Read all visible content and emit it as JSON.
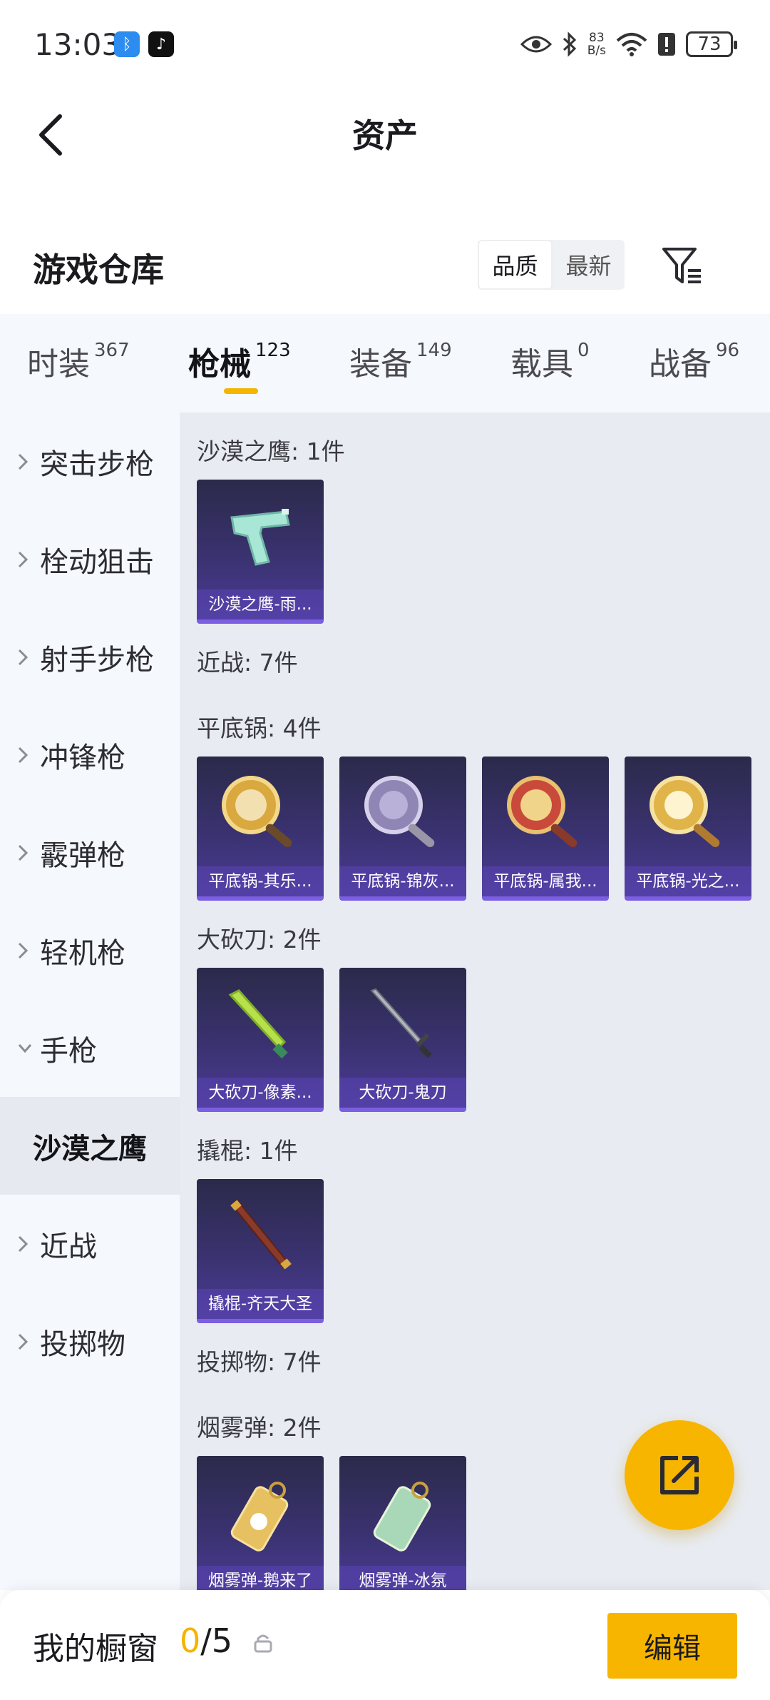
{
  "status_bar": {
    "time": "13:03",
    "net_speed_value": "83",
    "net_speed_unit": "B/s",
    "battery": "73"
  },
  "header": {
    "title": "资产"
  },
  "warehouse": {
    "title": "游戏仓库",
    "sort_options": [
      "品质",
      "最新"
    ],
    "active_sort": "品质"
  },
  "tabs": [
    {
      "label": "时装",
      "count": "367"
    },
    {
      "label": "枪械",
      "count": "123"
    },
    {
      "label": "装备",
      "count": "149"
    },
    {
      "label": "载具",
      "count": "0"
    },
    {
      "label": "战备",
      "count": "96"
    }
  ],
  "active_tab": "枪械",
  "sidebar": [
    {
      "label": "突击步枪"
    },
    {
      "label": "栓动狙击"
    },
    {
      "label": "射手步枪"
    },
    {
      "label": "冲锋枪"
    },
    {
      "label": "霰弹枪"
    },
    {
      "label": "轻机枪"
    },
    {
      "label": "手枪"
    },
    {
      "label": "沙漠之鹰"
    },
    {
      "label": "近战"
    },
    {
      "label": "投掷物"
    }
  ],
  "content": {
    "groups": [
      {
        "label": "沙漠之鹰: 1件",
        "items": [
          {
            "name": "沙漠之鹰-雨...",
            "icon": "pistol-icon"
          }
        ]
      },
      {
        "label": "近战: 7件",
        "items": []
      },
      {
        "label": "平底锅: 4件",
        "items": [
          {
            "name": "平底锅-其乐...",
            "icon": "pan-icon"
          },
          {
            "name": "平底锅-锦灰...",
            "icon": "pan-icon"
          },
          {
            "name": "平底锅-属我...",
            "icon": "pan-icon"
          },
          {
            "name": "平底锅-光之...",
            "icon": "pan-icon"
          }
        ]
      },
      {
        "label": "大砍刀: 2件",
        "items": [
          {
            "name": "大砍刀-像素...",
            "icon": "machete-icon"
          },
          {
            "name": "大砍刀-鬼刀",
            "icon": "sword-icon"
          }
        ]
      },
      {
        "label": "撬棍: 1件",
        "items": [
          {
            "name": "撬棍-齐天大圣",
            "icon": "staff-icon"
          }
        ]
      },
      {
        "label": "投掷物: 7件",
        "items": []
      },
      {
        "label": "烟雾弹: 2件",
        "items": [
          {
            "name": "烟雾弹-鹅来了",
            "icon": "grenade-icon"
          },
          {
            "name": "烟雾弹-冰氛",
            "icon": "grenade-icon"
          }
        ]
      }
    ]
  },
  "bottom_bar": {
    "title": "我的橱窗",
    "current": "0",
    "separator_total": "/5",
    "edit_label": "编辑"
  },
  "colors": {
    "accent": "#f5b400",
    "card_top": "#2b2a4a",
    "card_bottom": "#4b3b95",
    "card_border": "#7b5fe0",
    "content_bg": "#e8ecf2",
    "sidebar_bg": "#f5f8fc"
  }
}
